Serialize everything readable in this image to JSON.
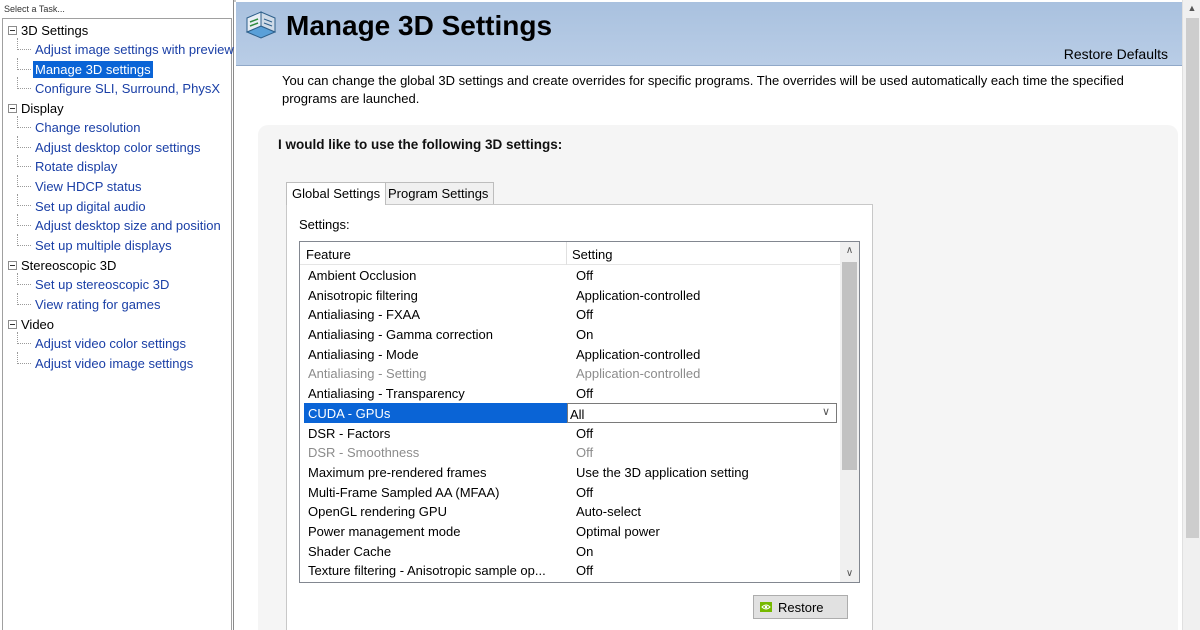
{
  "sidebar": {
    "title": "Select a Task...",
    "groups": [
      {
        "label": "3D Settings",
        "items": [
          {
            "label": "Adjust image settings with preview"
          },
          {
            "label": "Manage 3D settings",
            "selected": true
          },
          {
            "label": "Configure SLI, Surround, PhysX"
          }
        ]
      },
      {
        "label": "Display",
        "items": [
          {
            "label": "Change resolution"
          },
          {
            "label": "Adjust desktop color settings"
          },
          {
            "label": "Rotate display"
          },
          {
            "label": "View HDCP status"
          },
          {
            "label": "Set up digital audio"
          },
          {
            "label": "Adjust desktop size and position"
          },
          {
            "label": "Set up multiple displays"
          }
        ]
      },
      {
        "label": "Stereoscopic 3D",
        "items": [
          {
            "label": "Set up stereoscopic 3D"
          },
          {
            "label": "View rating for games"
          }
        ]
      },
      {
        "label": "Video",
        "items": [
          {
            "label": "Adjust video color settings"
          },
          {
            "label": "Adjust video image settings"
          }
        ]
      }
    ]
  },
  "header": {
    "title": "Manage 3D Settings",
    "restore_defaults": "Restore Defaults"
  },
  "description": "You can change the global 3D settings and create overrides for specific programs. The overrides will be used automatically each time the specified programs are launched.",
  "panel": {
    "heading": "I would like to use the following 3D settings:",
    "tabs": [
      {
        "label": "Global Settings",
        "active": true
      },
      {
        "label": "Program Settings",
        "active": false
      }
    ],
    "settings_label": "Settings:",
    "columns": {
      "feature": "Feature",
      "setting": "Setting"
    },
    "rows": [
      {
        "feature": "Ambient Occlusion",
        "setting": "Off"
      },
      {
        "feature": "Anisotropic filtering",
        "setting": "Application-controlled"
      },
      {
        "feature": "Antialiasing - FXAA",
        "setting": "Off"
      },
      {
        "feature": "Antialiasing - Gamma correction",
        "setting": "On"
      },
      {
        "feature": "Antialiasing - Mode",
        "setting": "Application-controlled"
      },
      {
        "feature": "Antialiasing - Setting",
        "setting": "Application-controlled",
        "disabled": true
      },
      {
        "feature": "Antialiasing - Transparency",
        "setting": "Off"
      },
      {
        "feature": "CUDA - GPUs",
        "setting": "All",
        "selected": true
      },
      {
        "feature": "DSR - Factors",
        "setting": "Off"
      },
      {
        "feature": "DSR - Smoothness",
        "setting": "Off",
        "disabled": true
      },
      {
        "feature": "Maximum pre-rendered frames",
        "setting": "Use the 3D application setting"
      },
      {
        "feature": "Multi-Frame Sampled AA (MFAA)",
        "setting": "Off"
      },
      {
        "feature": "OpenGL rendering GPU",
        "setting": "Auto-select"
      },
      {
        "feature": "Power management mode",
        "setting": "Optimal power"
      },
      {
        "feature": "Shader Cache",
        "setting": "On"
      },
      {
        "feature": "Texture filtering - Anisotropic sample op...",
        "setting": "Off"
      }
    ],
    "restore_button": "Restore"
  },
  "colors": {
    "selection": "#0a64d6",
    "link": "#1a3fa6",
    "header_bg": "#a9c1df",
    "nvidia_green": "#76b900"
  },
  "icons": {
    "header": "3d-settings-icon",
    "restore": "nvidia-logo-icon",
    "dropdown": "chevron-down-icon"
  }
}
